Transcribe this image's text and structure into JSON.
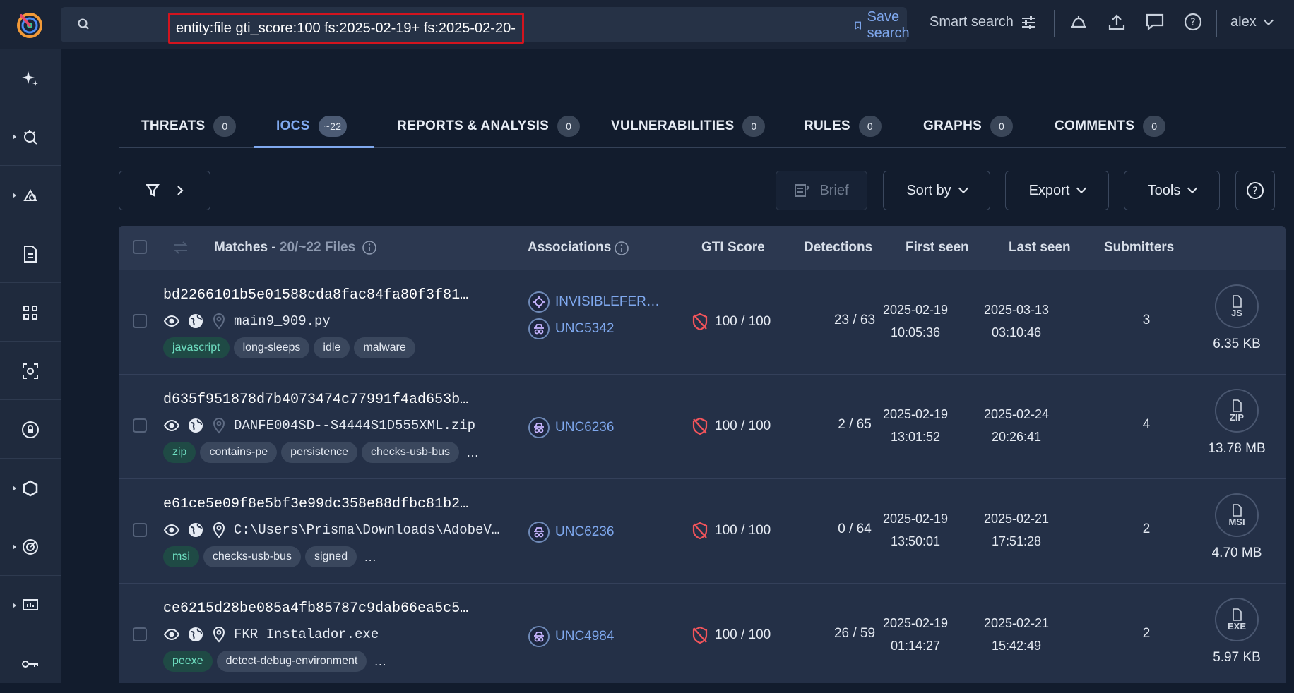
{
  "search": {
    "query": "entity:file gti_score:100 fs:2025-02-19+ fs:2025-02-20-",
    "save_label": "Save search",
    "smart_label": "Smart search"
  },
  "user": {
    "name": "alex"
  },
  "tabs": [
    {
      "label": "THREATS",
      "count": "0"
    },
    {
      "label": "IOCS",
      "count": "~22"
    },
    {
      "label": "REPORTS & ANALYSIS",
      "count": "0"
    },
    {
      "label": "VULNERABILITIES",
      "count": "0"
    },
    {
      "label": "RULES",
      "count": "0"
    },
    {
      "label": "GRAPHS",
      "count": "0"
    },
    {
      "label": "COMMENTS",
      "count": "0"
    }
  ],
  "toolbar": {
    "brief": "Brief",
    "sort": "Sort by",
    "export": "Export",
    "tools": "Tools"
  },
  "table": {
    "headers": {
      "matches": "Matches -",
      "matches_count": "20/~22 Files",
      "associations": "Associations",
      "gti": "GTI Score",
      "detections": "Detections",
      "first_seen": "First seen",
      "last_seen": "Last seen",
      "submitters": "Submitters"
    },
    "rows": [
      {
        "hash": "bd2266101b5e01588cda8fac84fa80f3f81…",
        "filename": "main9_909.py",
        "tags": [
          "javascript",
          "long-sleeps",
          "idle",
          "malware"
        ],
        "more": "",
        "associations": [
          {
            "name": "INVISIBLEFER…",
            "icon": "malware-icon"
          },
          {
            "name": "UNC5342",
            "icon": "threat-actor-icon"
          }
        ],
        "score": "100 / 100",
        "detections": "23 / 63",
        "first_date": "2025-02-19",
        "first_time": "10:05:36",
        "last_date": "2025-03-13",
        "last_time": "03:10:46",
        "submitters": "3",
        "filetype": "JS",
        "size": "6.35 KB"
      },
      {
        "hash": "d635f951878d7b4073474c77991f4ad653b…",
        "filename": "DANFE004SD--S4444S1D555XML.zip",
        "tags": [
          "zip",
          "contains-pe",
          "persistence",
          "checks-usb-bus"
        ],
        "more": "…",
        "associations": [
          {
            "name": "UNC6236",
            "icon": "threat-actor-icon"
          }
        ],
        "score": "100 / 100",
        "detections": "2 / 65",
        "first_date": "2025-02-19",
        "first_time": "13:01:52",
        "last_date": "2025-02-24",
        "last_time": "20:26:41",
        "submitters": "4",
        "filetype": "ZIP",
        "size": "13.78 MB"
      },
      {
        "hash": "e61ce5e09f8e5bf3e99dc358e88dfbc81b2…",
        "filename": "C:\\Users\\Prisma\\Downloads\\AdobeV…",
        "tags": [
          "msi",
          "checks-usb-bus",
          "signed"
        ],
        "more": "…",
        "associations": [
          {
            "name": "UNC6236",
            "icon": "threat-actor-icon"
          }
        ],
        "score": "100 / 100",
        "detections": "0 / 64",
        "first_date": "2025-02-19",
        "first_time": "13:50:01",
        "last_date": "2025-02-21",
        "last_time": "17:51:28",
        "submitters": "2",
        "filetype": "MSI",
        "size": "4.70 MB"
      },
      {
        "hash": "ce6215d28be085a4fb85787c9dab66ea5c5…",
        "filename": "FKR Instalador.exe",
        "tags": [
          "peexe",
          "detect-debug-environment"
        ],
        "more": "…",
        "associations": [
          {
            "name": "UNC4984",
            "icon": "threat-actor-icon"
          }
        ],
        "score": "100 / 100",
        "detections": "26 / 59",
        "first_date": "2025-02-19",
        "first_time": "01:14:27",
        "last_date": "2025-02-21",
        "last_time": "15:42:49",
        "submitters": "2",
        "filetype": "EXE",
        "size": "5.97 KB"
      }
    ]
  },
  "colors": {
    "accent": "#7fa8ee",
    "danger": "#f2545b",
    "highlight_border": "#d2141e"
  }
}
